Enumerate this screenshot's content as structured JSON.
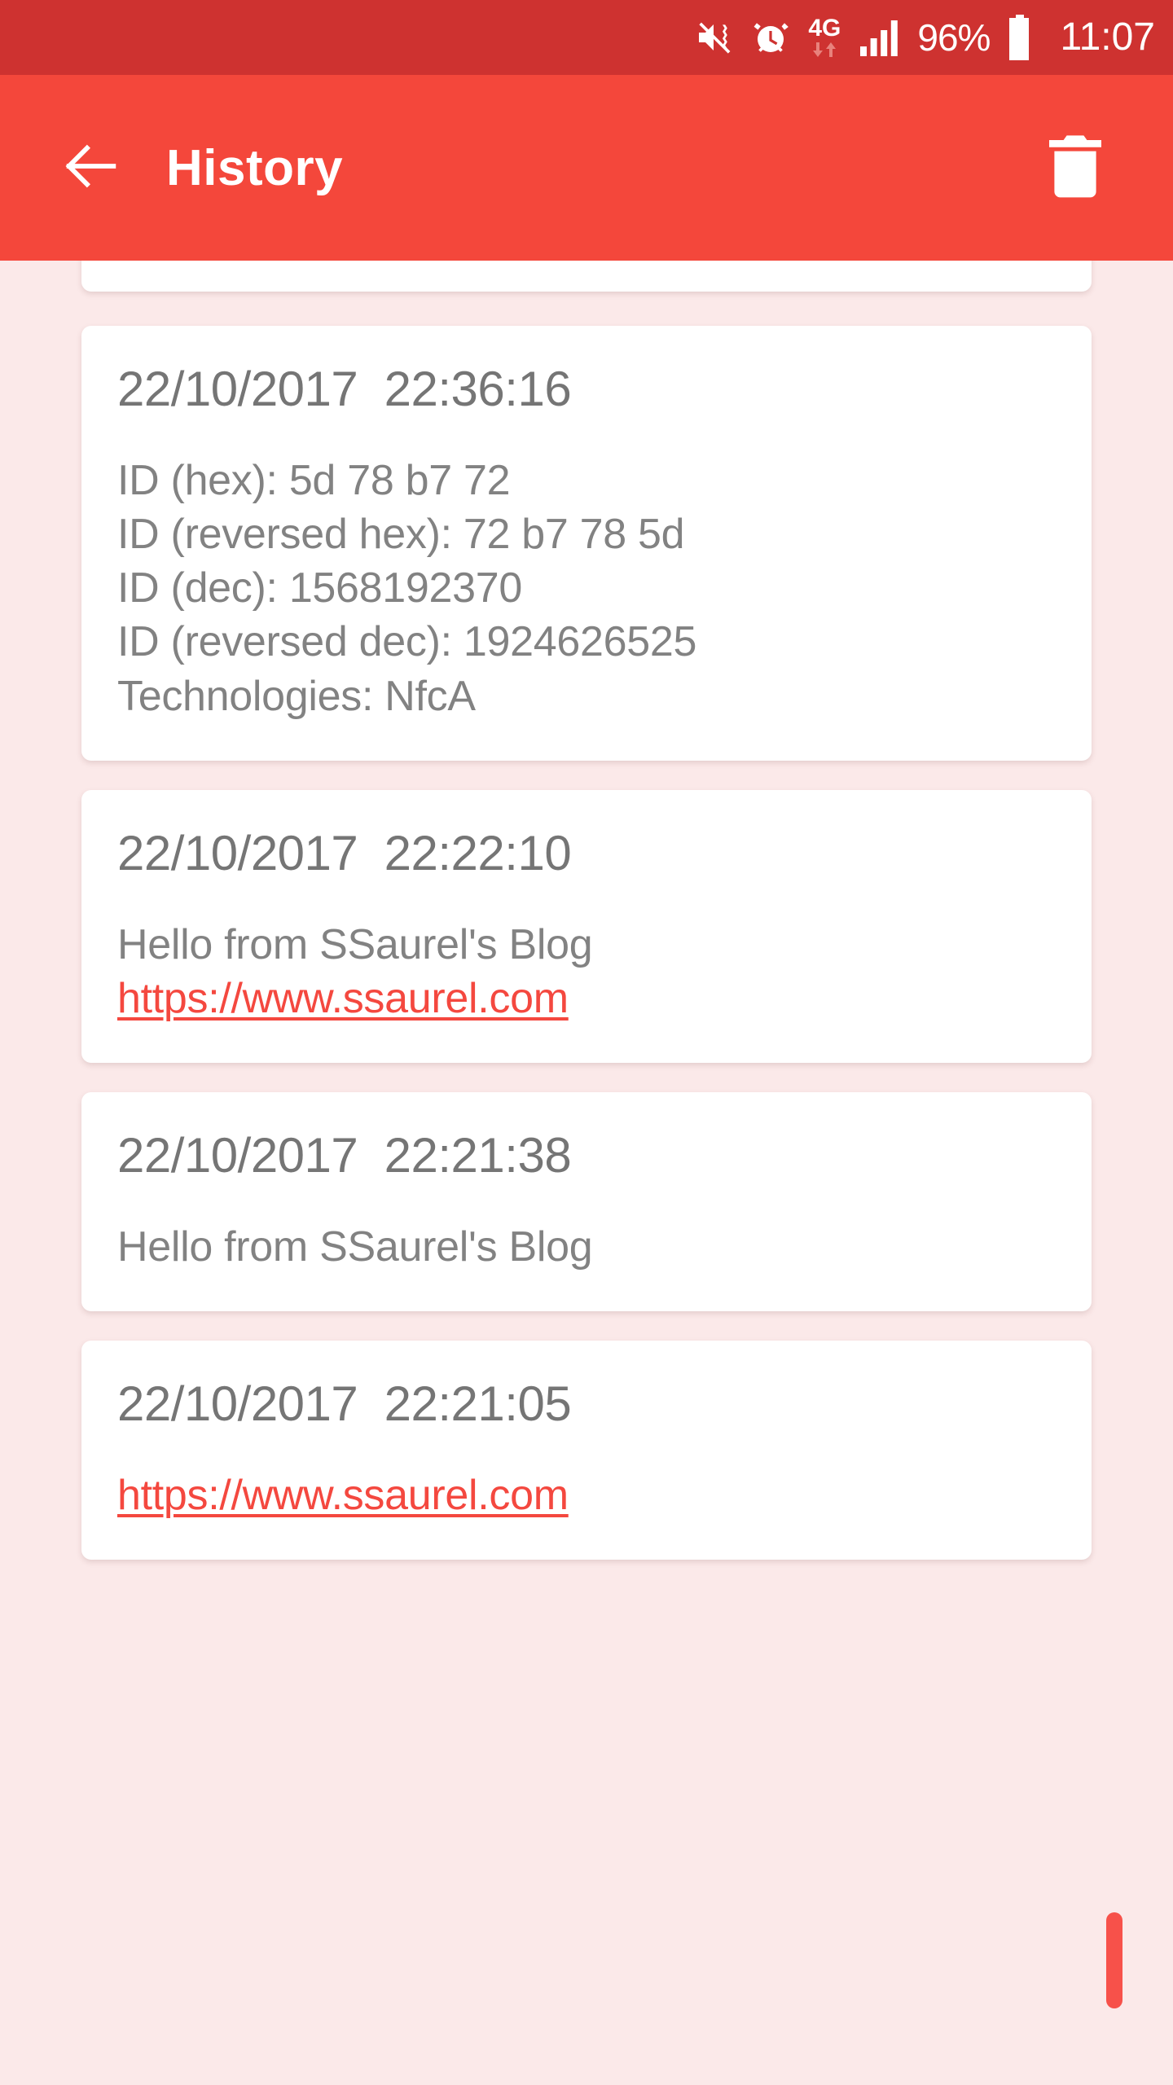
{
  "status_bar": {
    "background": "#CE3230",
    "battery_percent": "96%",
    "time": "11:07",
    "network_label": "4G",
    "icons": [
      "mute-vibrate-icon",
      "alarm-clock-icon",
      "network-4g-icon",
      "signal-bars-icon",
      "battery-icon"
    ]
  },
  "app_bar": {
    "background": "#F4473B",
    "title": "History",
    "back_icon": "back-arrow-icon",
    "delete_icon": "trash-icon"
  },
  "theme": {
    "page_background": "#FBE9E9",
    "card_background": "#FFFFFF",
    "accent": "#F4483F",
    "text_primary": "#757575",
    "text_secondary": "#828282",
    "scrollbar": "#F7514A"
  },
  "history": {
    "cards": [
      {
        "id": "card-partial-top",
        "partial": true,
        "date": "",
        "lines": []
      },
      {
        "id": "card-nfc-tag",
        "partial": false,
        "date": "22/10/2017  22:36:16",
        "lines": [
          {
            "type": "text",
            "value": "ID (hex): 5d 78 b7 72"
          },
          {
            "type": "text",
            "value": "ID (reversed hex): 72 b7 78 5d"
          },
          {
            "type": "text",
            "value": "ID (dec): 1568192370"
          },
          {
            "type": "text",
            "value": "ID (reversed dec): 1924626525"
          },
          {
            "type": "text",
            "value": "Technologies: NfcA"
          }
        ]
      },
      {
        "id": "card-message-with-link",
        "partial": false,
        "date": "22/10/2017  22:22:10",
        "lines": [
          {
            "type": "text",
            "value": "Hello from SSaurel's Blog"
          },
          {
            "type": "link",
            "value": "https://www.ssaurel.com"
          }
        ]
      },
      {
        "id": "card-message-only",
        "partial": false,
        "date": "22/10/2017  22:21:38",
        "lines": [
          {
            "type": "text",
            "value": "Hello from SSaurel's Blog"
          }
        ]
      },
      {
        "id": "card-link-only",
        "partial": false,
        "date": "22/10/2017  22:21:05",
        "lines": [
          {
            "type": "link",
            "value": "https://www.ssaurel.com"
          }
        ]
      }
    ]
  }
}
